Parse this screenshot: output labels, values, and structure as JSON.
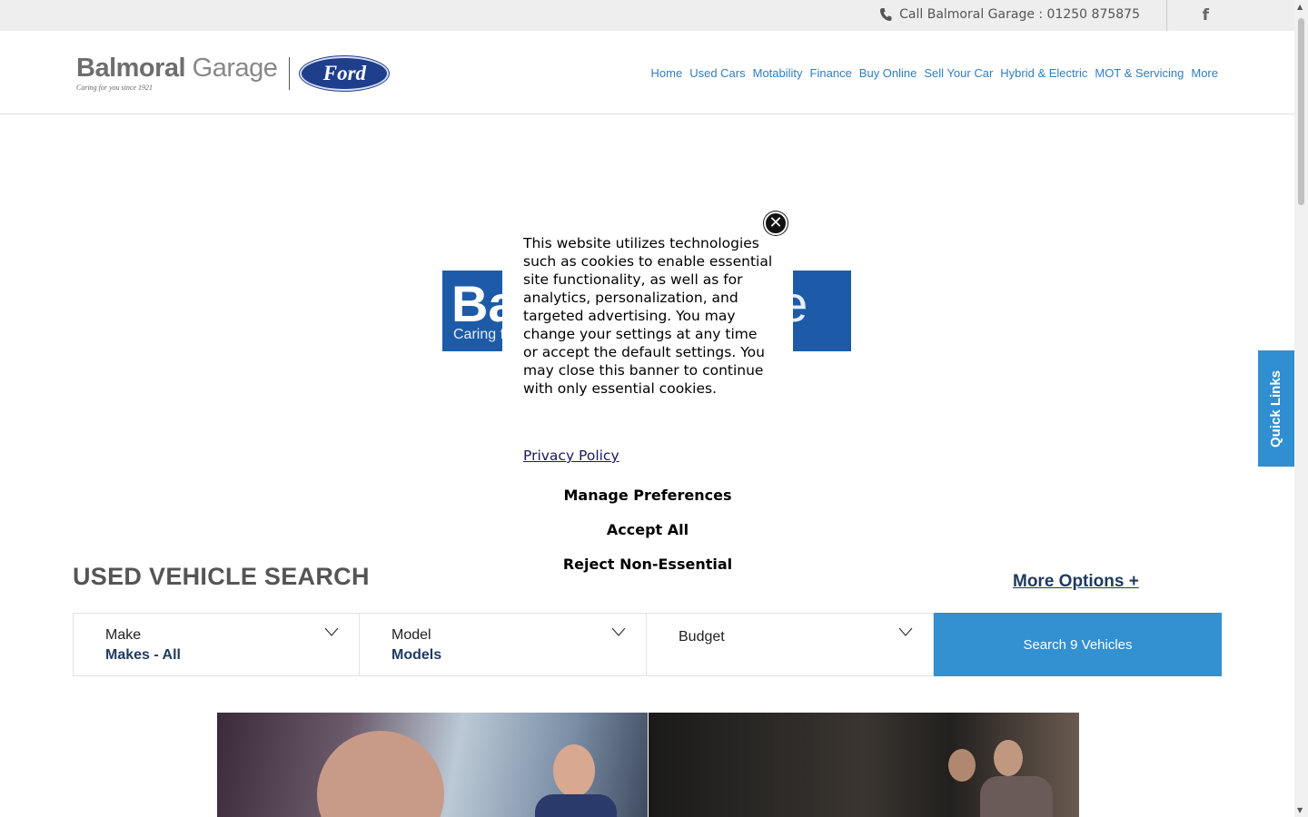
{
  "topbar": {
    "call_text": "Call Balmoral Garage : 01250 875875",
    "facebook_glyph": "f"
  },
  "logo": {
    "brand_bold": "Balmoral",
    "brand_light": " Garage",
    "tagline": "Caring for you since 1921",
    "ford": "Ford"
  },
  "nav": [
    "Home",
    "Used Cars",
    "Motability",
    "Finance",
    "Buy Online",
    "Sell Your Car",
    "Hybrid & Electric",
    "MOT & Servicing",
    "More"
  ],
  "hero": {
    "text_left": "Ba",
    "text_right": "ge",
    "tag_left": "Caring f"
  },
  "cookie": {
    "message": "This website utilizes technologies such as cookies to enable essential site functionality, as well as for analytics, personalization, and targeted advertising. You may change your settings at any time or accept the default settings. You may close this banner to continue with only essential cookies.",
    "privacy_link": "Privacy Policy",
    "manage": "Manage Preferences",
    "accept": "Accept All",
    "reject": "Reject Non-Essential",
    "close_glyph": "✕"
  },
  "quick_links": "Quick Links",
  "search": {
    "title": "USED VEHICLE SEARCH",
    "more_options": "More Options +",
    "filters": [
      {
        "label": "Make",
        "value": "Makes - All"
      },
      {
        "label": "Model",
        "value": "Models"
      },
      {
        "label": "Budget",
        "value": ""
      }
    ],
    "button": "Search 9 Vehicles"
  }
}
